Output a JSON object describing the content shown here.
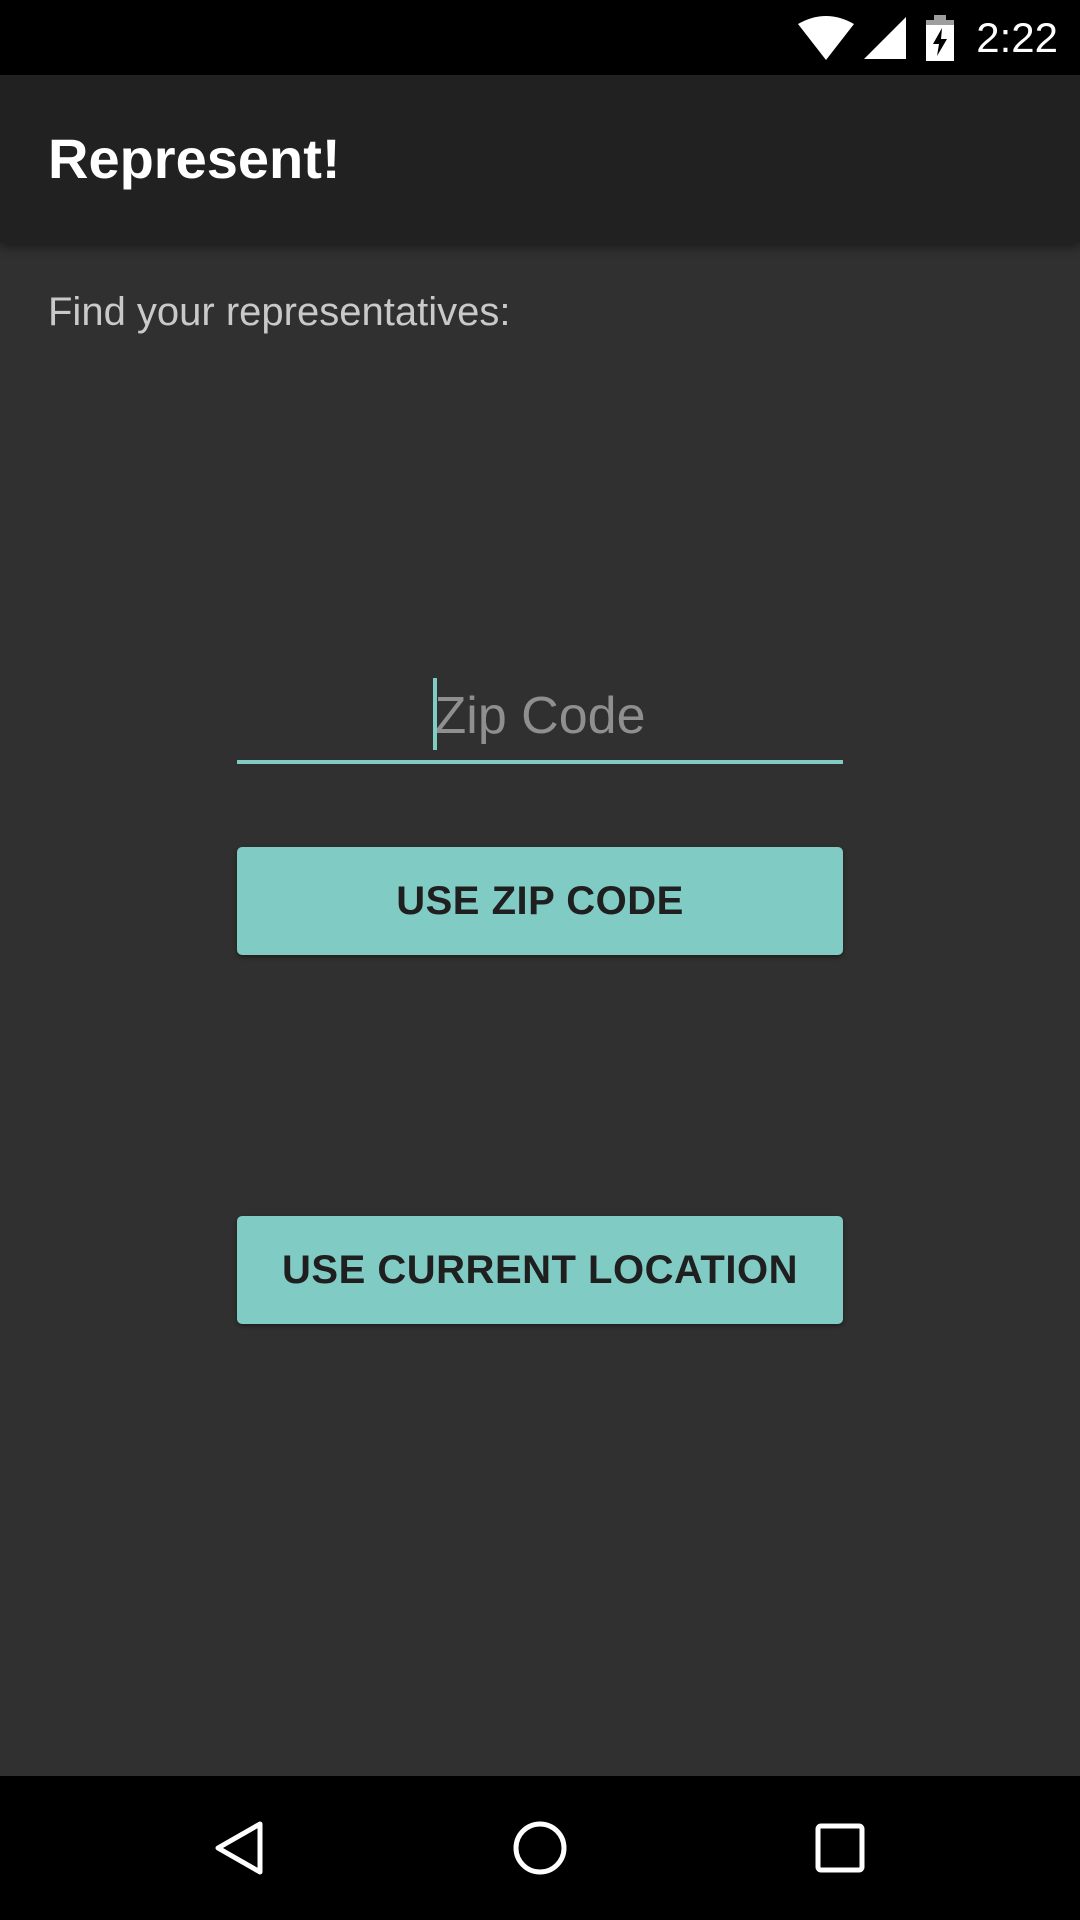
{
  "status_bar": {
    "time": "2:22",
    "icons": [
      "wifi-icon",
      "signal-icon",
      "battery-charging-icon"
    ]
  },
  "app_bar": {
    "title": "Represent!"
  },
  "main": {
    "prompt": "Find your representatives:",
    "zip_input": {
      "placeholder": "Zip Code",
      "value": ""
    },
    "use_zip_button": "USE ZIP CODE",
    "use_location_button": "USE CURRENT LOCATION"
  },
  "nav_bar": {
    "icons": [
      "back-icon",
      "home-icon",
      "recents-icon"
    ]
  },
  "colors": {
    "accent": "#80cbc4",
    "background": "#303030",
    "app_bar": "#212121",
    "system_bars": "#000000"
  }
}
